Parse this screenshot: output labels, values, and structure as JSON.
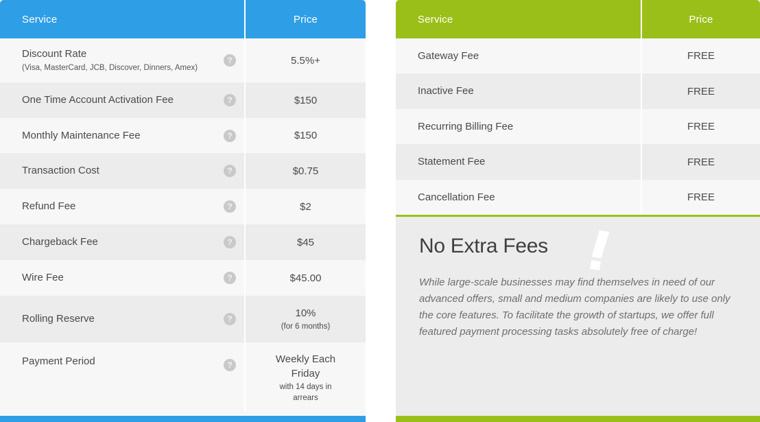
{
  "left_table": {
    "accent_color": "#2e9fe6",
    "columns": [
      "Service",
      "Price"
    ],
    "rows": [
      {
        "service": "Discount Rate",
        "service_sub": "(Visa, MasterCard, JCB, Discover, Dinners, Amex)",
        "price": "5.5%+",
        "price_sub": "",
        "help": "?"
      },
      {
        "service": "One Time Account Activation Fee",
        "service_sub": "",
        "price": "$150",
        "price_sub": "",
        "help": "?"
      },
      {
        "service": "Monthly Maintenance Fee",
        "service_sub": "",
        "price": "$150",
        "price_sub": "",
        "help": "?"
      },
      {
        "service": "Transaction Cost",
        "service_sub": "",
        "price": "$0.75",
        "price_sub": "",
        "help": "?"
      },
      {
        "service": "Refund Fee",
        "service_sub": "",
        "price": "$2",
        "price_sub": "",
        "help": "?"
      },
      {
        "service": "Chargeback Fee",
        "service_sub": "",
        "price": "$45",
        "price_sub": "",
        "help": "?"
      },
      {
        "service": "Wire Fee",
        "service_sub": "",
        "price": "$45.00",
        "price_sub": "",
        "help": "?"
      },
      {
        "service": "Rolling Reserve",
        "service_sub": "",
        "price": "10%",
        "price_sub": "(for 6 months)",
        "help": "?"
      },
      {
        "service": "Payment Period",
        "service_sub": "",
        "price": "Weekly Each Friday",
        "price_sub": "with 14 days in arrears",
        "help": "?"
      }
    ]
  },
  "right_table": {
    "accent_color": "#9bbf19",
    "columns": [
      "Service",
      "Price"
    ],
    "rows": [
      {
        "service": "Gateway Fee",
        "price": "FREE"
      },
      {
        "service": "Inactive Fee",
        "price": "FREE"
      },
      {
        "service": "Recurring Billing Fee",
        "price": "FREE"
      },
      {
        "service": "Statement Fee",
        "price": "FREE"
      },
      {
        "service": "Cancellation Fee",
        "price": "FREE"
      }
    ]
  },
  "promo": {
    "title": "No Extra Fees",
    "exclamation": "!",
    "text": "While large-scale businesses may find themselves in need of our advanced offers, small and medium companies are likely to use only the core features. To facilitate the growth of startups, we offer full featured payment processing tasks absolutely free of charge!"
  }
}
